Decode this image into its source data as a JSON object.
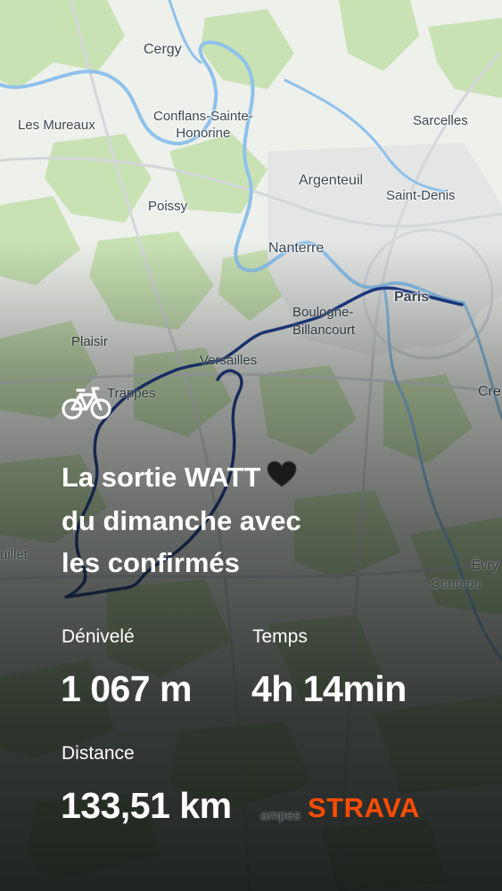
{
  "map": {
    "places": {
      "cergy": "Cergy",
      "les_mureaux": "Les Mureaux",
      "conflans": "Conflans-Sainte-\nHonorine",
      "sarcelles": "Sarcelles",
      "argenteuil": "Argenteuil",
      "saint_denis": "Saint-Denis",
      "poissy": "Poissy",
      "nanterre": "Nanterre",
      "paris": "Paris",
      "boulogne": "Boulogne-\nBillancourt",
      "plaisir": "Plaisir",
      "versailles": "Versailles",
      "trappes": "Trappes",
      "creteil_partial": "Cre",
      "partial_left": "uillet",
      "evry_partial": "Évry",
      "courcouronnes_partial": "Courcou",
      "etampes_partial": "ampes"
    },
    "colors": {
      "land": "#eef0ec",
      "green": "#c9e2b4",
      "water": "#8fc2ea",
      "route": "#1f3e8f",
      "roads": "#d8dcdf"
    }
  },
  "activity": {
    "type_icon": "bicycle-icon",
    "title": "La sortie WATT 🖤\ndu dimanche avec\nles confirmés",
    "title_lines": [
      "La sortie WATT",
      "du dimanche avec",
      "les confirmés"
    ],
    "stats": {
      "elevation_label": "Dénivelé",
      "elevation_value": "1 067 m",
      "time_label": "Temps",
      "time_value": "4h 14min",
      "distance_label": "Distance",
      "distance_value": "133,51 km"
    }
  },
  "brand": {
    "name": "STRAVA",
    "color": "#fc4c02"
  }
}
